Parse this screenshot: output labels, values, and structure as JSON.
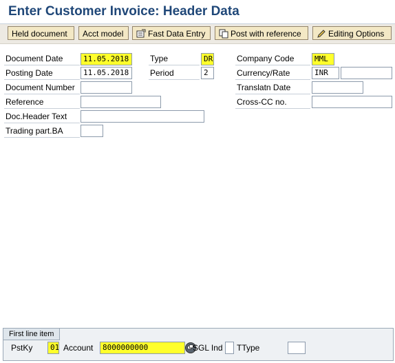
{
  "title": "Enter Customer Invoice: Header Data",
  "toolbar": {
    "held_document": "Held document",
    "acct_model": "Acct model",
    "fast_data_entry": "Fast Data Entry",
    "post_with_reference": "Post with reference",
    "editing_options": "Editing Options"
  },
  "form": {
    "document_date": {
      "label": "Document Date",
      "value": "11.05.2018"
    },
    "posting_date": {
      "label": "Posting Date",
      "value": "11.05.2018"
    },
    "document_number": {
      "label": "Document Number",
      "value": ""
    },
    "reference": {
      "label": "Reference",
      "value": ""
    },
    "doc_header_text": {
      "label": "Doc.Header Text",
      "value": ""
    },
    "trading_part_ba": {
      "label": "Trading part.BA",
      "value": ""
    },
    "type": {
      "label": "Type",
      "value": "DR"
    },
    "period": {
      "label": "Period",
      "value": "2"
    },
    "company_code": {
      "label": "Company Code",
      "value": "MML"
    },
    "currency_rate": {
      "label": "Currency/Rate",
      "currency": "INR",
      "rate": ""
    },
    "translatn_date": {
      "label": "Translatn Date",
      "value": ""
    },
    "cross_cc_no": {
      "label": "Cross-CC no.",
      "value": ""
    }
  },
  "first_line_item": {
    "title": "First line item",
    "pstky_label": "PstKy",
    "pstky_value": "01",
    "account_label": "Account",
    "account_value": "8000000000",
    "sgl_ind_label": "SGL Ind",
    "sgl_ind_value": "",
    "ttype_label": "TType",
    "ttype_value": ""
  },
  "colors": {
    "title": "#1f4778",
    "required_field": "#ffff2b",
    "button": "#f3e8c5"
  }
}
